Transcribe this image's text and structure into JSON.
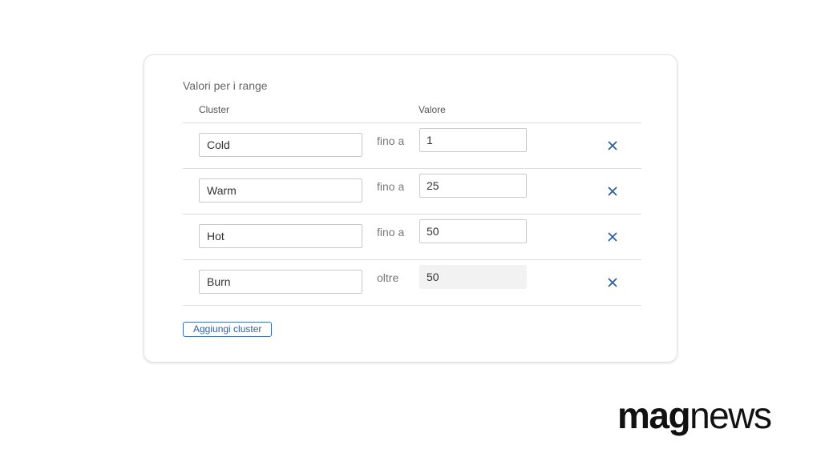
{
  "panel": {
    "title": "Valori per i range",
    "columns": {
      "cluster": "Cluster",
      "value": "Valore"
    },
    "rows": [
      {
        "name": "Cold",
        "operator": "fino a",
        "value": "1",
        "editable": true
      },
      {
        "name": "Warm",
        "operator": "fino a",
        "value": "25",
        "editable": true
      },
      {
        "name": "Hot",
        "operator": "fino a",
        "value": "50",
        "editable": true
      },
      {
        "name": "Burn",
        "operator": "oltre",
        "value": "50",
        "editable": false
      }
    ],
    "add_button_label": "Aggiungi cluster",
    "remove_icon": "close-icon",
    "accent_color": "#2f5f9f"
  },
  "brand": {
    "logo_bold": "mag",
    "logo_light": "news"
  }
}
